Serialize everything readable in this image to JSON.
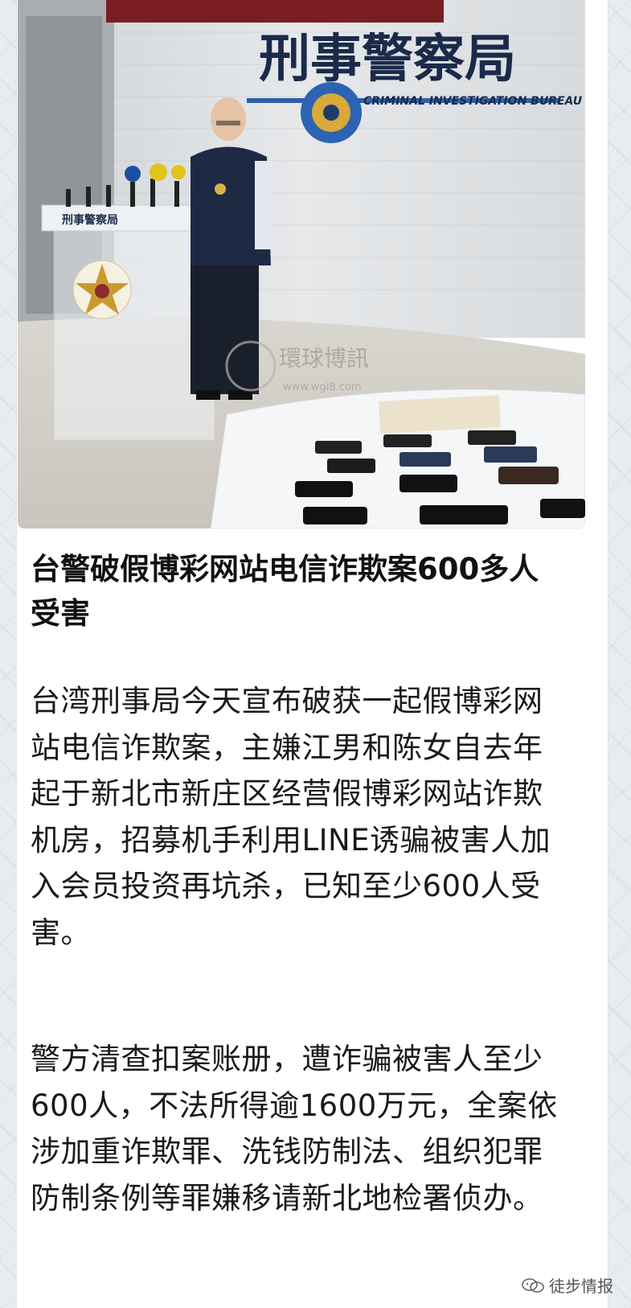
{
  "photo": {
    "wall_sign_cn": "刑事警察局",
    "wall_sign_en": "CRIMINAL INVESTIGATION BUREAU",
    "podium_sign": "刑事警察局",
    "watermark_cn": "環球博訊",
    "watermark_url": "www.wgi8.com"
  },
  "article": {
    "headline": "台警破假博彩网站电信诈欺案600多人受害",
    "paragraph_1": "台湾刑事局今天宣布破获一起假博彩网站电信诈欺案，主嫌江男和陈女自去年起于新北市新庄区经营假博彩网站诈欺机房，招募机手利用LINE诱骗被害人加入会员投资再坑杀，已知至少600人受害。",
    "paragraph_2": "警方清查扣案账册，遭诈骗被害人至少600人，不法所得逾1600万元，全案依涉加重诈欺罪、洗钱防制法、组织犯罪防制条例等罪嫌移请新北地检署侦办。"
  },
  "footer": {
    "watermark_label": "徒步情报"
  }
}
